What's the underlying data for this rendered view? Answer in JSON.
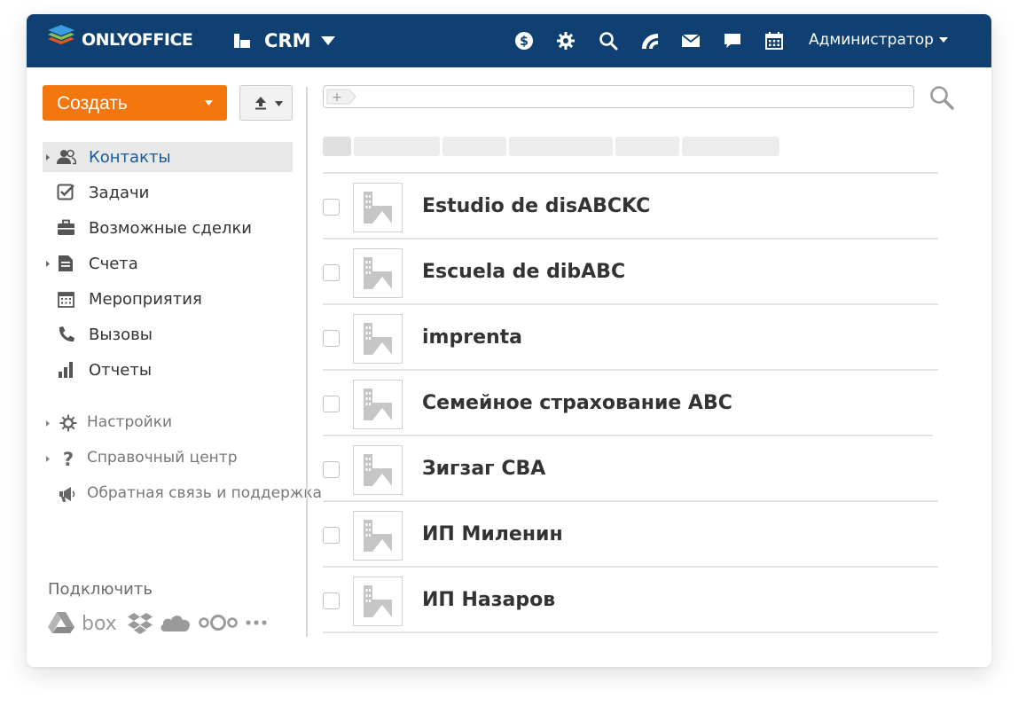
{
  "header": {
    "logo_text": "ONLYOFFICE",
    "module_label": "CRM",
    "user_name": "Администратор",
    "icons": [
      "billing-icon",
      "settings-icon",
      "search-icon",
      "feed-icon",
      "mail-icon",
      "chat-icon",
      "calendar-icon"
    ],
    "background_color": "#0f4071"
  },
  "toolbar": {
    "create_label": "Создать",
    "create_color": "#f4770e"
  },
  "sidebar": {
    "items": [
      {
        "label": "Контакты",
        "icon": "contacts-icon",
        "active": true,
        "expandable": true
      },
      {
        "label": "Задачи",
        "icon": "tasks-icon",
        "active": false,
        "expandable": false
      },
      {
        "label": "Возможные сделки",
        "icon": "deals-icon",
        "active": false,
        "expandable": false
      },
      {
        "label": "Счета",
        "icon": "invoices-icon",
        "active": false,
        "expandable": true
      },
      {
        "label": "Мероприятия",
        "icon": "events-icon",
        "active": false,
        "expandable": false
      },
      {
        "label": "Вызовы",
        "icon": "phone-icon",
        "active": false,
        "expandable": false
      },
      {
        "label": "Отчеты",
        "icon": "reports-icon",
        "active": false,
        "expandable": false
      }
    ],
    "secondary": [
      {
        "label": "Настройки",
        "icon": "gear-icon"
      },
      {
        "label": "Справочный центр",
        "icon": "question-icon"
      },
      {
        "label": "Обратная связь и поддержка",
        "icon": "megaphone-icon"
      }
    ],
    "connect_title": "Подключить",
    "connect_services": [
      "google-drive-icon",
      "box-icon",
      "dropbox-icon",
      "onedrive-icon",
      "nextcloud-icon",
      "more-icon"
    ]
  },
  "contacts": [
    {
      "name": "Estudio de disABCKC"
    },
    {
      "name": "Escuela de dibABC"
    },
    {
      "name": "imprenta"
    },
    {
      "name": "Семейное страхование ABC"
    },
    {
      "name": "Зигзаг CBA"
    },
    {
      "name": "ИП Миленин"
    },
    {
      "name": "ИП Назаров"
    }
  ]
}
